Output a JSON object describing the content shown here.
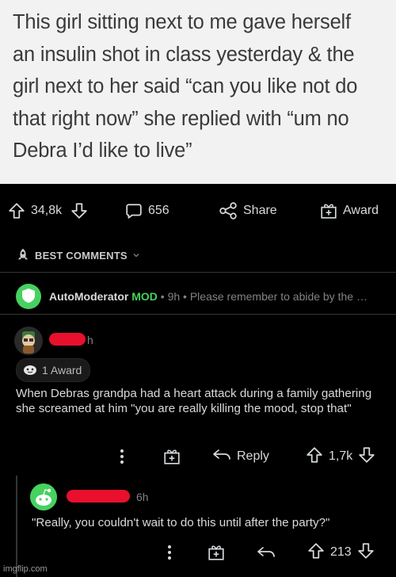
{
  "tweet": {
    "lines": [
      "This girl sitting next to me gave herself",
      "an insulin shot in class yesterday & the",
      "girl next to her said “can you like not do",
      "that right now” she replied with “um no",
      "Debra I’d like to live”"
    ]
  },
  "post_actions": {
    "votes": "34,8k",
    "comments": "656",
    "share_label": "Share",
    "award_label": "Award"
  },
  "sort": {
    "label": "BEST COMMENTS"
  },
  "automod": {
    "name": "AutoModerator",
    "badge": "MOD",
    "separator1": "•",
    "age": "9h",
    "separator2": "•",
    "snippet": "Please remember to abide by the …"
  },
  "comment1": {
    "age_suffix": "h",
    "award_text": "1 Award",
    "body": "When Debras grandpa had a heart attack during a family gathering she screamed at him \"you are really killing the mood, stop that\"",
    "reply_label": "Reply",
    "votes": "1,7k"
  },
  "comment2": {
    "age": "6h",
    "body": "\"Really, you couldn't wait to do this until after the party?\"",
    "votes": "213"
  },
  "watermark": "imgflip.com",
  "colors": {
    "mod_green": "#46d160",
    "redaction": "#e8102c",
    "background": "#000000",
    "tweet_bg": "#f2f2f2"
  }
}
